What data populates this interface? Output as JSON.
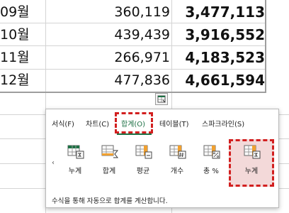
{
  "table": {
    "rows": [
      {
        "month": "09월",
        "value": "360,119",
        "cumulative": "3,477,113"
      },
      {
        "month": "10월",
        "value": "439,439",
        "cumulative": "3,916,552"
      },
      {
        "month": "11월",
        "value": "266,971",
        "cumulative": "4,183,523"
      },
      {
        "month": "12월",
        "value": "477,836",
        "cumulative": "4,661,594"
      }
    ]
  },
  "quick_analysis": {
    "tabs": [
      {
        "label": "서식(F)"
      },
      {
        "label": "차트(C)"
      },
      {
        "label": "합계(O)"
      },
      {
        "label": "테이블(T)"
      },
      {
        "label": "스파크라인(S)"
      }
    ],
    "active_tab": "합계(O)",
    "tiles": [
      {
        "label": "누계",
        "icon": "running-total-row-icon"
      },
      {
        "label": "합계",
        "icon": "sum-icon"
      },
      {
        "label": "평균",
        "icon": "average-icon"
      },
      {
        "label": "개수",
        "icon": "count-icon"
      },
      {
        "label": "총 %",
        "icon": "percent-total-icon"
      },
      {
        "label": "누계",
        "icon": "running-total-column-icon"
      }
    ],
    "selected_tile": "누계",
    "description": "수식을 통해 자동으로 합계를 계산합니다.",
    "scroll_glyph": "‹",
    "colors": {
      "highlight": "#d21f1f",
      "accent": "#1e7145",
      "icon_orange": "#f0a030",
      "icon_green": "#1e7145"
    }
  }
}
